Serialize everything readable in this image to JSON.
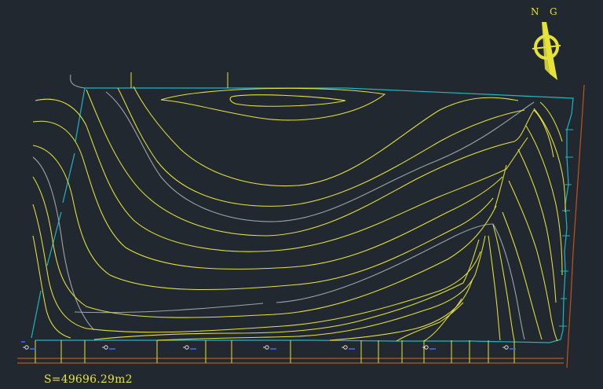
{
  "drawing": {
    "area_label": "S=49696.29m2",
    "north_label_left": "N",
    "north_label_right": "G"
  },
  "colors": {
    "background": "#212830",
    "contour": "#e6e23a",
    "index_contour": "#9ea2ab",
    "boundary": "#1fb6c1",
    "road_edge": "#c0551f",
    "symbol": "#3d6bf2"
  },
  "icons": [
    "north-arrow-icon",
    "survey-marker-icon"
  ]
}
